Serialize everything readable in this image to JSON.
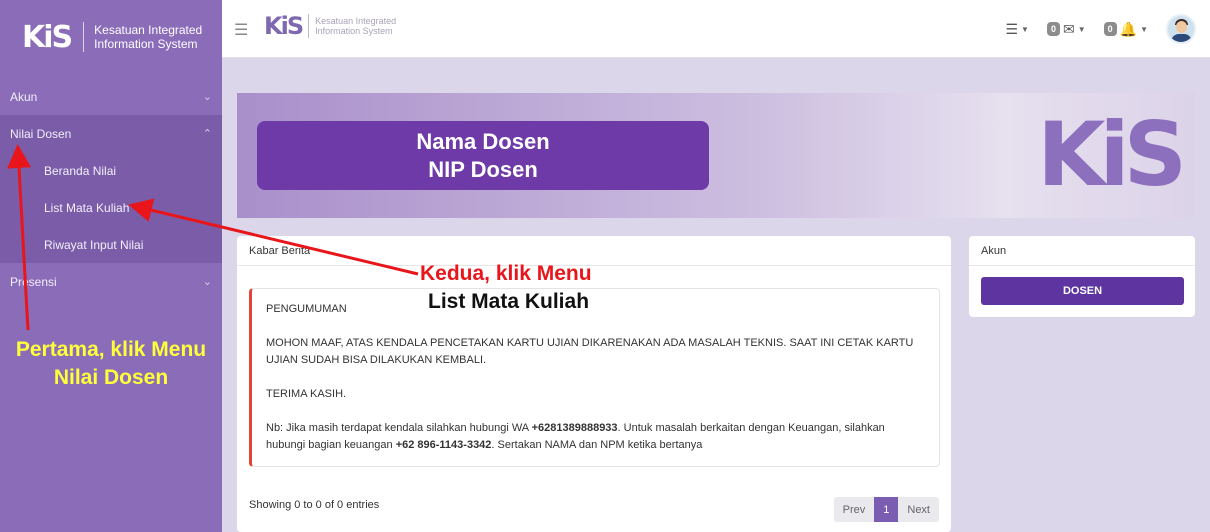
{
  "sidebar": {
    "brand_logo": "KiS",
    "brand_line1": "Kesatuan Integrated",
    "brand_line2": "Information System",
    "menu": {
      "akun": "Akun",
      "nilai_dosen": "Nilai Dosen",
      "presensi": "Presensi"
    },
    "submenu": {
      "beranda_nilai": "Beranda Nilai",
      "list_mata_kuliah": "List Mata Kuliah",
      "riwayat_input_nilai": "Riwayat Input Nilai"
    }
  },
  "topbar": {
    "logo": "KiS",
    "logo_line1": "Kesatuan Integrated",
    "logo_line2": "Information System",
    "messages_count": "0",
    "notifications_count": "0"
  },
  "banner": {
    "line1": "Nama Dosen",
    "line2": "NIP Dosen",
    "logo": "KiS"
  },
  "berita": {
    "header": "Kabar Berita",
    "announcement_title": "PENGUMUMAN",
    "announcement_body": "MOHON MAAF, ATAS KENDALA PENCETAKAN KARTU UJIAN DIKARENAKAN ADA MASALAH TEKNIS. SAAT INI CETAK KARTU UJIAN SUDAH BISA DILAKUKAN KEMBALI.",
    "thanks": "TERIMA KASIH.",
    "note_prefix": "Nb: Jika masih terdapat kendala silahkan hubungi WA ",
    "note_wa": "+6281389888933",
    "note_middle": ". Untuk masalah berkaitan dengan Keuangan, silahkan hubungi bagian keuangan ",
    "note_finance": "+62 896-1143-3342",
    "note_suffix": ". Sertakan NAMA dan NPM ketika bertanya",
    "showing": "Showing 0 to 0 of 0 entries",
    "pager": {
      "prev": "Prev",
      "page": "1",
      "next": "Next"
    }
  },
  "akun_card": {
    "header": "Akun",
    "button": "DOSEN"
  },
  "annotations": {
    "first_line1": "Pertama, klik Menu",
    "first_line2": "Nilai Dosen",
    "second_line1": "Kedua, klik Menu",
    "second_line2": "List Mata Kuliah"
  },
  "colors": {
    "sidebar": "#8a6cb8",
    "accent": "#5e35a0",
    "alert_border": "#e0453a",
    "annotation_red": "#e8161b",
    "annotation_yellow": "#ffff3a"
  }
}
